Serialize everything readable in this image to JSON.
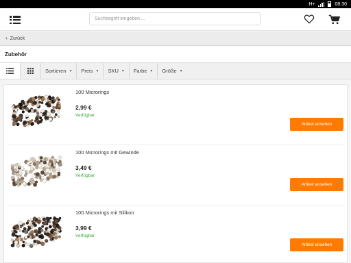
{
  "statusbar": {
    "network": "H+",
    "time": "08:30"
  },
  "appbar": {
    "search_placeholder": "Suchbegriff eingeben ...",
    "icons": [
      "menu-icon",
      "heart-icon",
      "cart-icon"
    ]
  },
  "back": {
    "label": "Zurück"
  },
  "category": {
    "title": "Zubehör"
  },
  "filters": {
    "view_modes": [
      "list-view-icon",
      "grid-view-icon"
    ],
    "active_view": "list",
    "items": [
      {
        "label": "Sortieren"
      },
      {
        "label": "Preis"
      },
      {
        "label": "SKU"
      },
      {
        "label": "Farbe"
      },
      {
        "label": "Größe"
      }
    ]
  },
  "products": [
    {
      "name": "100 Microrings",
      "price": "2,99 €",
      "availability": "Verfügbar",
      "button": "Artikel ansehen",
      "image": "mixed-color-microrings"
    },
    {
      "name": "100 Microrings mit Gewinde",
      "price": "3,49 €",
      "availability": "Verfügbar",
      "button": "Artikel ansehen",
      "image": "light-color-microrings"
    },
    {
      "name": "100 Microrings mit Silikon",
      "price": "3,99 €",
      "availability": "Verfügbar",
      "button": "Artikel ansehen",
      "image": "mixed-color-microrings"
    }
  ],
  "colors": {
    "accent": "#ff7a00",
    "available": "#3aa63a"
  }
}
